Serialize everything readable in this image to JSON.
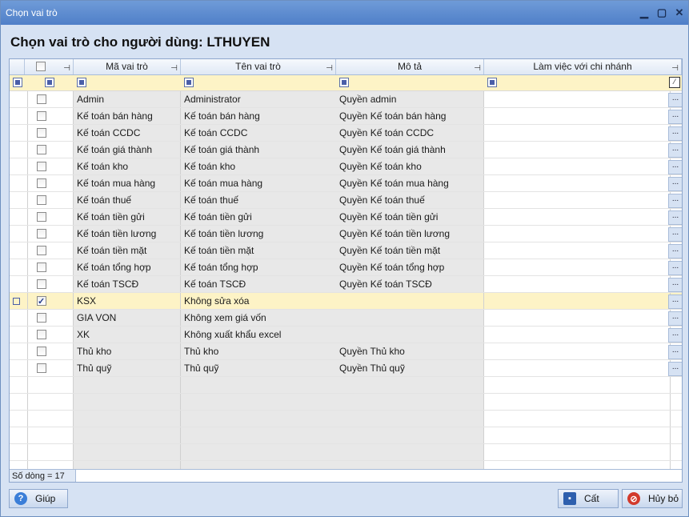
{
  "window": {
    "title": "Chọn vai trò"
  },
  "heading": "Chọn vai trò cho người dùng: LTHUYEN",
  "columns": {
    "ma": "Mã vai trò",
    "ten": "Tên vai trò",
    "mota": "Mô tả",
    "lamviec": "Làm việc với chi nhánh"
  },
  "rows": [
    {
      "ma": "Admin",
      "ten": "Administrator",
      "mota": "Quyền admin",
      "checked": false
    },
    {
      "ma": "Kế toán bán hàng",
      "ten": "Kế toán bán hàng",
      "mota": "Quyền Kế toán bán hàng",
      "checked": false
    },
    {
      "ma": "Kế toán CCDC",
      "ten": "Kế toán CCDC",
      "mota": "Quyền Kế toán CCDC",
      "checked": false
    },
    {
      "ma": "Kế toán giá thành",
      "ten": "Kế toán giá thành",
      "mota": "Quyền Kế toán giá thành",
      "checked": false
    },
    {
      "ma": "Kế toán kho",
      "ten": "Kế toán kho",
      "mota": "Quyền Kế toán kho",
      "checked": false
    },
    {
      "ma": "Kế toán mua hàng",
      "ten": "Kế toán mua hàng",
      "mota": "Quyền Kế toán mua hàng",
      "checked": false
    },
    {
      "ma": "Kế toán thuế",
      "ten": "Kế toán thuế",
      "mota": "Quyền Kế toán thuế",
      "checked": false
    },
    {
      "ma": "Kế toán tiền gửi",
      "ten": "Kế toán tiền gửi",
      "mota": "Quyền Kế toán tiền gửi",
      "checked": false
    },
    {
      "ma": "Kế toán tiền lương",
      "ten": "Kế toán tiền lương",
      "mota": "Quyền Kế toán tiền lương",
      "checked": false
    },
    {
      "ma": "Kế toán tiền mặt",
      "ten": "Kế toán tiền mặt",
      "mota": "Quyền Kế toán tiền mặt",
      "checked": false
    },
    {
      "ma": "Kế toán tổng hợp",
      "ten": "Kế toán tổng hợp",
      "mota": "Quyền Kế toán tổng hợp",
      "checked": false
    },
    {
      "ma": "Kế toán TSCĐ",
      "ten": "Kế toán TSCĐ",
      "mota": "Quyền Kế toán TSCĐ",
      "checked": false
    },
    {
      "ma": "KSX",
      "ten": "Không sửa xóa",
      "mota": "",
      "checked": true,
      "selected": true
    },
    {
      "ma": "GIA VON",
      "ten": "Không xem giá vốn",
      "mota": "",
      "checked": false
    },
    {
      "ma": "XK",
      "ten": "Không xuất khẩu excel",
      "mota": "",
      "checked": false
    },
    {
      "ma": "Thủ kho",
      "ten": "Thủ kho",
      "mota": "Quyền Thủ kho",
      "checked": false
    },
    {
      "ma": "Thủ quỹ",
      "ten": "Thủ quỹ",
      "mota": "Quyền Thủ quỹ",
      "checked": false
    }
  ],
  "row_button_label": "...",
  "row_count": "Số dòng = 17",
  "buttons": {
    "help": "Giúp",
    "save": "Cất",
    "cancel": "Hủy bỏ"
  },
  "icons": {
    "help": "question-icon",
    "save": "floppy-disk-icon",
    "cancel": "cancel-circle-icon"
  }
}
